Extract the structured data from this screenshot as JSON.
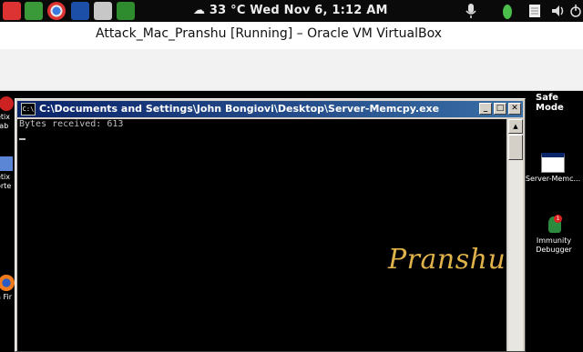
{
  "panel": {
    "clock": "☁ 33 °C  Wed Nov  6,  1:12 AM",
    "launchers": [
      "gmail-icon",
      "leaf-icon",
      "chrome-icon",
      "device-icon",
      "remote-icon",
      "download-icon"
    ],
    "tray": [
      "microphone-icon",
      "leaf-icon",
      "notes-icon",
      "volume-icon",
      "power-icon"
    ],
    "colors": {
      "panel_bg": "#0a0a0a"
    }
  },
  "vbox": {
    "title": "Attack_Mac_Pranshu [Running] – Oracle VM VirtualBox"
  },
  "guest": {
    "safe_mode": "Safe Mode",
    "left_icons": [
      {
        "label": "etix\nrab",
        "icon": "app-icon"
      },
      {
        "label": "etix\norte",
        "icon": "document-icon"
      },
      {
        "label": "a Fir",
        "icon": "firefox-icon"
      }
    ],
    "right_icons": [
      {
        "label": "Server-Memc...",
        "icon": "console-app-icon"
      },
      {
        "label": "Immunity\nDebugger",
        "icon": "immunity-debugger-icon"
      }
    ]
  },
  "console": {
    "title": "C:\\Documents and Settings\\John Bongiovi\\Desktop\\Server-Memcpy.exe",
    "icon_text": "C:\\",
    "output": "Bytes received: 613",
    "buttons": {
      "minimize": "_",
      "maximize": "□",
      "close": "✕"
    }
  },
  "watermark": "Pranshu"
}
